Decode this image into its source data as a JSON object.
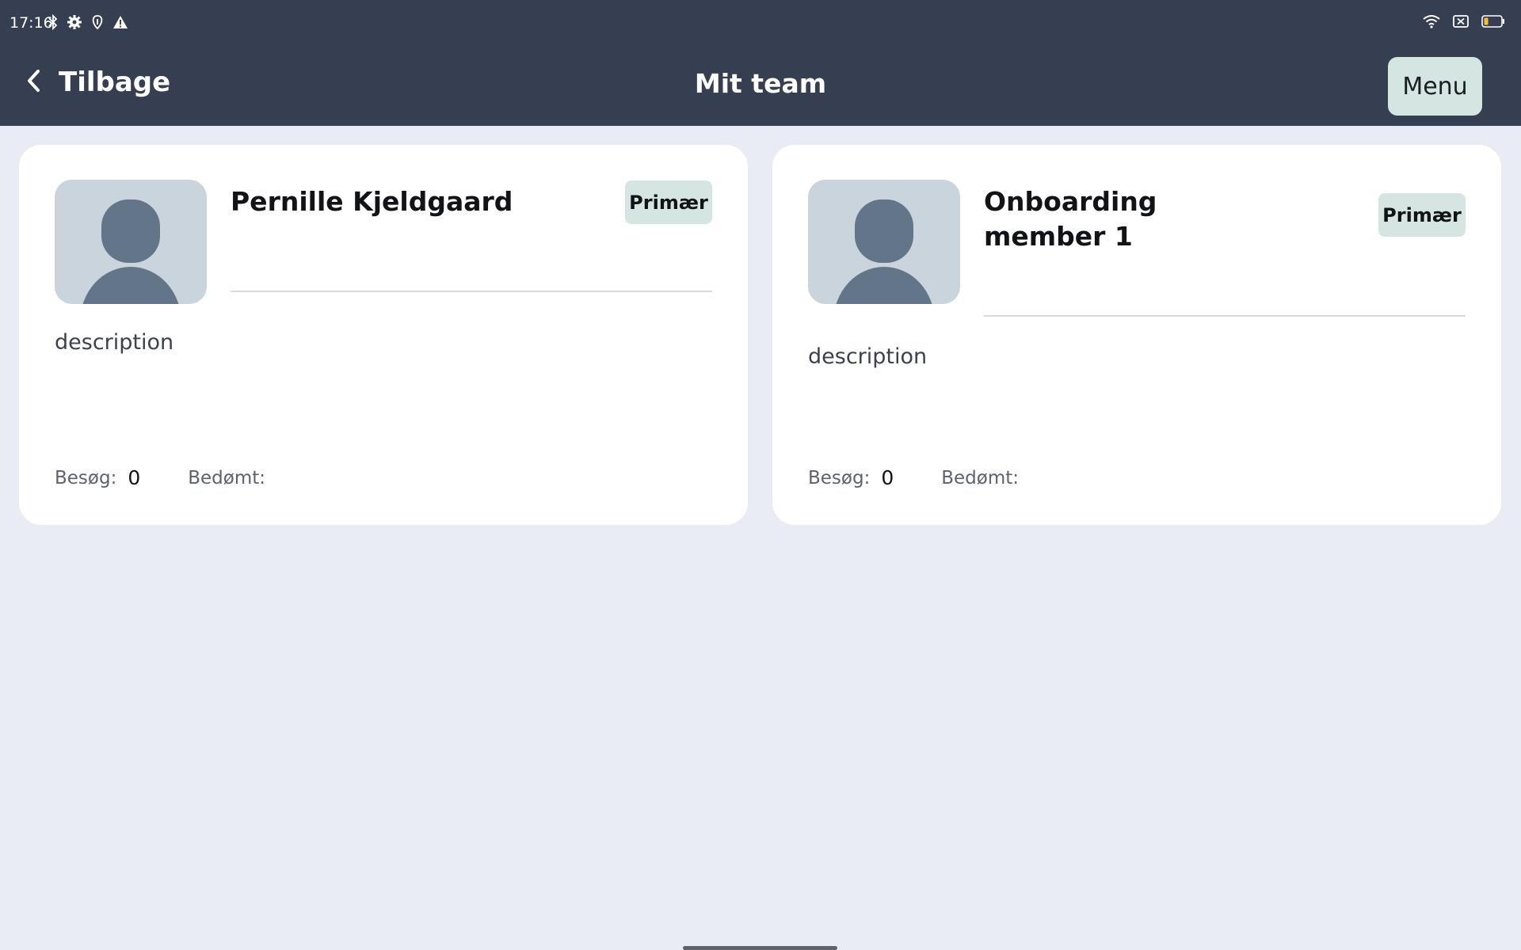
{
  "status_bar": {
    "time": "17:16",
    "left_icons": [
      "bluetooth-icon",
      "settings-gear-icon",
      "vpn-key-icon",
      "warning-icon"
    ],
    "right_icons": [
      "wifi-icon",
      "sim-x-icon",
      "battery-low-icon"
    ]
  },
  "nav": {
    "back_label": "Tilbage",
    "title": "Mit team",
    "menu_label": "Menu"
  },
  "colors": {
    "header_bg": "#363e51",
    "page_bg": "#e9ecf4",
    "badge_bg": "#d5e5e1",
    "avatar_bg": "#c9d4dc",
    "avatar_fg": "#637689"
  },
  "members": [
    {
      "name": "Pernille Kjeldgaard",
      "badge": "Primær",
      "description": "description",
      "visits_label": "Besøg:",
      "visits_value": "0",
      "rated_label": "Bedømt:",
      "rated_value": ""
    },
    {
      "name": "Onboarding member 1",
      "badge": "Primær",
      "description": "description",
      "visits_label": "Besøg:",
      "visits_value": "0",
      "rated_label": "Bedømt:",
      "rated_value": ""
    }
  ]
}
